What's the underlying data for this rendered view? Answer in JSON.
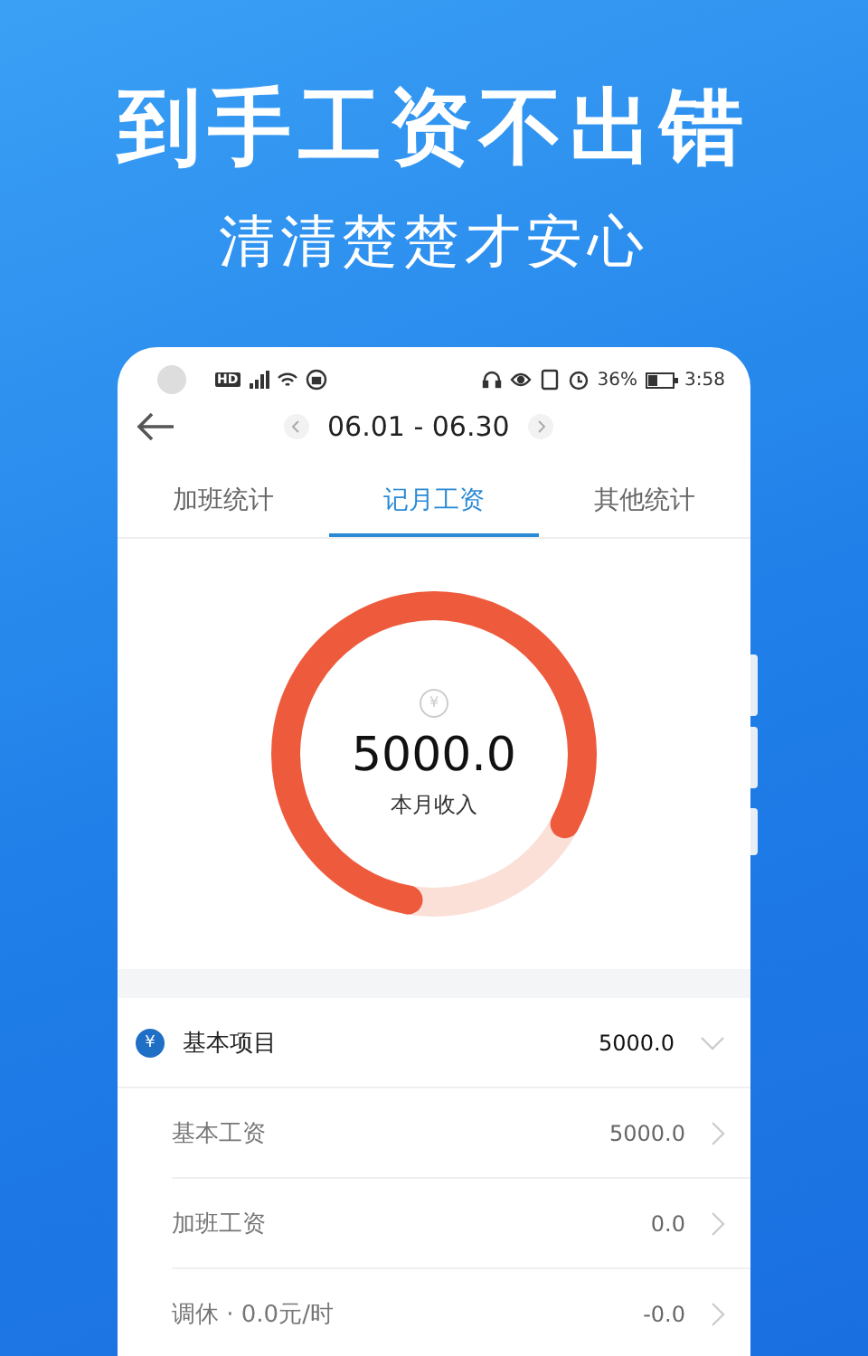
{
  "headline": "到手工资不出错",
  "subheadline": "清清楚楚才安心",
  "status_bar": {
    "badge": "HD",
    "battery": "36%",
    "time": "3:58"
  },
  "date_range": "06.01 - 06.30",
  "tabs": [
    {
      "label": "加班统计",
      "selected": false
    },
    {
      "label": "记月工资",
      "selected": true
    },
    {
      "label": "其他统计",
      "selected": false
    }
  ],
  "income": {
    "symbol": "¥",
    "amount": "5000.0",
    "label": "本月收入",
    "level": 0.8
  },
  "section": {
    "symbol": "¥",
    "title": "基本项目",
    "total": "5000.0",
    "expanded": true
  },
  "items": [
    {
      "label": "基本工资",
      "value": "5000.0"
    },
    {
      "label": "加班工资",
      "value": "0.0"
    },
    {
      "label": "调休 · 0.0元/时",
      "value": "-0.0"
    }
  ]
}
